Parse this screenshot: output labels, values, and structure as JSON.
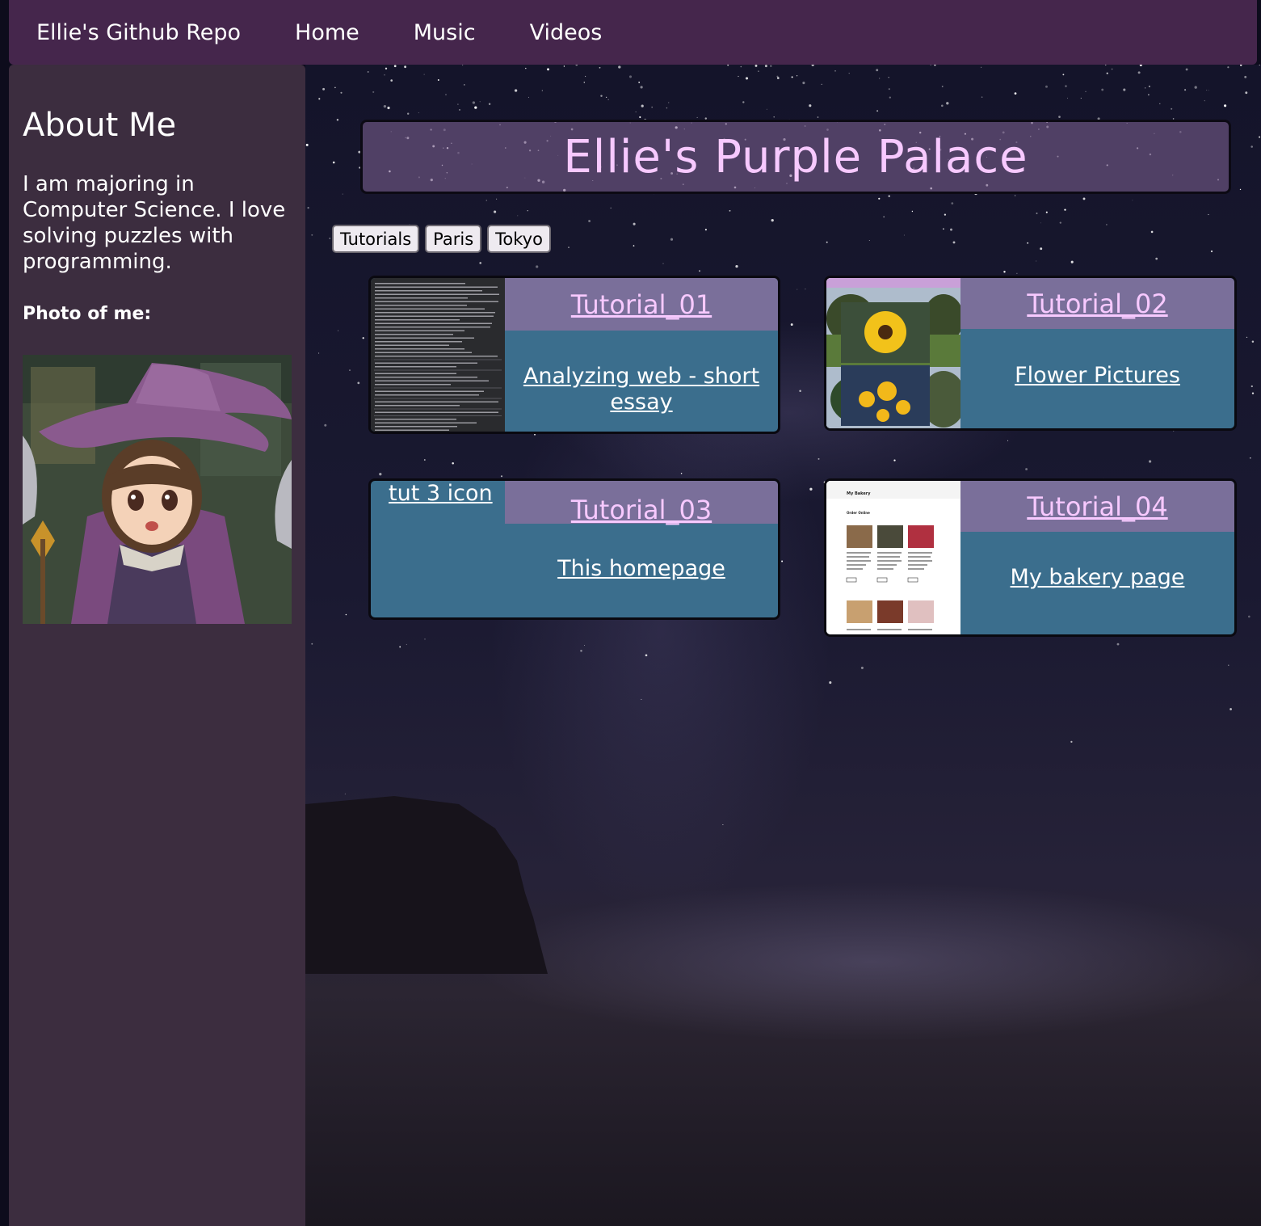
{
  "nav": {
    "brand": "Ellie's Github Repo",
    "items": [
      "Home",
      "Music",
      "Videos"
    ]
  },
  "sidebar": {
    "title": "About Me",
    "text": "I am majoring in Computer Science. I love solving puzzles with programming.",
    "photo_label": "Photo of me:"
  },
  "banner": {
    "title": "Ellie's Purple Palace"
  },
  "filters": [
    "Tutorials",
    "Paris",
    "Tokyo"
  ],
  "cards": [
    {
      "title": "Tutorial_01",
      "desc": "Analyzing web - short essay"
    },
    {
      "title": "Tutorial_02",
      "desc": "Flower Pictures"
    },
    {
      "title": "Tutorial_03",
      "desc": "This homepage",
      "img_alt": "tut 3 icon"
    },
    {
      "title": "Tutorial_04",
      "desc": "My bakery page"
    }
  ],
  "bakery_thumb": {
    "title": "My Bakery",
    "subtitle": "Order Online"
  },
  "colors": {
    "nav": "#45264c",
    "sidebar": "#3c2d3f",
    "card": "#3b6e8d",
    "card_head": "#7a6f9a",
    "accent_text": "#f7c9ff"
  }
}
